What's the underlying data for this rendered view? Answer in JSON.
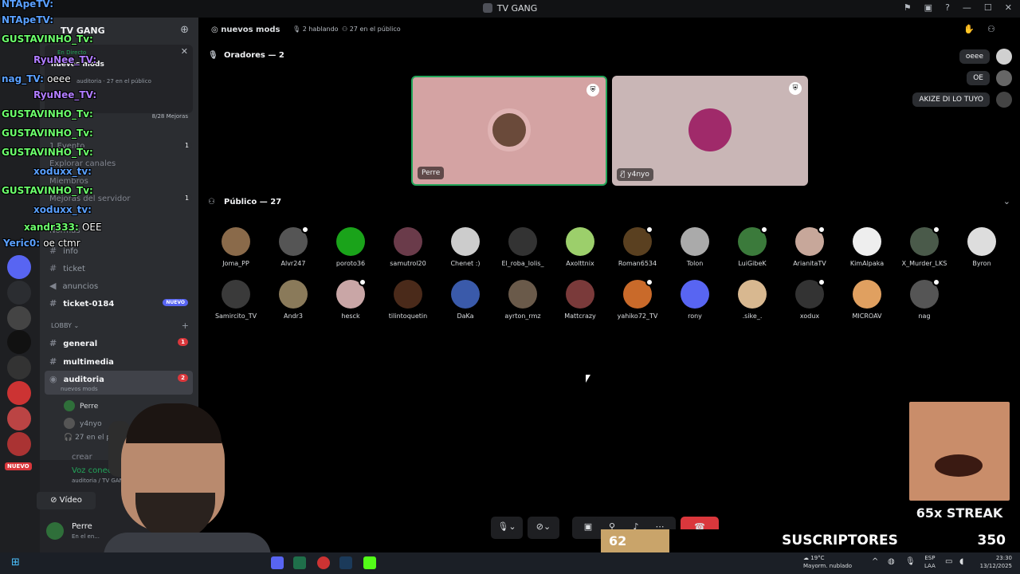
{
  "window": {
    "title": "TV GANG"
  },
  "sidebar": {
    "guild_name": "TV GANG",
    "live": {
      "status": "En Directo",
      "channel": "nuevos mods",
      "meta": "auditoria · 27 en el público"
    },
    "mejoras": "8/28 Mejoras",
    "rows": [
      {
        "label": "1 Evento",
        "count": "1"
      },
      {
        "label": "Explorar canales",
        "count": ""
      },
      {
        "label": "Miembros",
        "count": ""
      },
      {
        "label": "Mejoras del servidor",
        "count": "1"
      },
      {
        "label": "Normas",
        "count": ""
      }
    ],
    "channels": [
      {
        "name": "info"
      },
      {
        "name": "ticket"
      },
      {
        "name": "anuncios"
      },
      {
        "name": "ticket-0184",
        "pill": "NUEVO"
      }
    ],
    "lobby": "LOBBY",
    "lobby_channels": [
      {
        "name": "general",
        "badge": "1"
      },
      {
        "name": "multimedia",
        "badge": ""
      },
      {
        "name": "auditoria",
        "badge": "2",
        "sub": "nuevos mods"
      }
    ],
    "voice_members": [
      "Perre",
      "y4nyo",
      "27 en el público"
    ],
    "crear": "crear",
    "nuevo_badge": "NUEVO",
    "voice_connected": {
      "title": "Voz conectada",
      "sub": "auditoria / TV GANG",
      "video": "Vídeo"
    },
    "user": {
      "name": "Perre",
      "status": "En el en..."
    }
  },
  "stage": {
    "channel": "nuevos mods",
    "speaking": "2 hablando",
    "audience_count": "27 en el público",
    "speakers_header": "Oradores — 2",
    "audience_header": "Público — 27",
    "speakers": [
      {
        "name": "Perre"
      },
      {
        "name": "y4nyo"
      }
    ],
    "chat": [
      "oeee",
      "OE",
      "AKIZE DI LO TUYO"
    ],
    "audience": [
      "Joma_PP",
      "Alvr247",
      "poroto36",
      "samutrol20",
      "Chenet :)",
      "El_roba_lolis_",
      "Axolttnix",
      "Roman6534",
      "Tolon",
      "LuiGibeK",
      "ArianitaTV",
      "KimAlpaka",
      "X_Murder_LKS",
      "Byron",
      "Samircito_TV",
      "Andr3",
      "hesck",
      "tilintoquetin",
      "DaKa",
      "ayrton_rmz",
      "Mattcrazy",
      "yahiko72_TV",
      "rony",
      ".sike_.",
      "xodux",
      "MICROAV",
      "nag"
    ],
    "audience_colors": [
      "#8a6a4a",
      "#555",
      "#1aa31a",
      "#6a3b4a",
      "#ccc",
      "#333",
      "#9ccf6b",
      "#5a4020",
      "#aaa",
      "#3b7a3b",
      "#c7a79a",
      "#eee",
      "#4a5a4a",
      "#ddd",
      "#3a3a3a",
      "#8a7a5a",
      "#c9a6a6",
      "#4a2a1a",
      "#3a5aaa",
      "#6a5a4a",
      "#7a3a3a",
      "#c96a2a",
      "#5865f2",
      "#d8b890",
      "#333",
      "#e0a060",
      "#555"
    ],
    "accent": "#23a55a",
    "danger": "#da373c"
  },
  "overlay": {
    "chat": [
      {
        "user": "NTApeTV:",
        "msg": "",
        "color": "#5aa0ff"
      },
      {
        "user": "NTApeTV:",
        "msg": "",
        "color": "#5aa0ff"
      },
      {
        "user": "GUSTAVINHO_Tv:",
        "msg": "",
        "color": "#6cff6c"
      },
      {
        "user": "RyuNee_TV:",
        "msg": "",
        "color": "#b07cff"
      },
      {
        "user": "nag_TV:",
        "msg": "oeee",
        "color": "#5aa0ff"
      },
      {
        "user": "RyuNee_TV:",
        "msg": "",
        "color": "#b07cff"
      },
      {
        "user": "GUSTAVINHO_Tv:",
        "msg": "",
        "color": "#6cff6c"
      },
      {
        "user": "GUSTAVINHO_Tv:",
        "msg": "",
        "color": "#6cff6c"
      },
      {
        "user": "GUSTAVINHO_Tv:",
        "msg": "",
        "color": "#6cff6c"
      },
      {
        "user": "xoduxx_tv:",
        "msg": "",
        "color": "#5aa0ff"
      },
      {
        "user": "GUSTAVINHO_Tv:",
        "msg": "",
        "color": "#6cff6c"
      },
      {
        "user": "xoduxx_tv:",
        "msg": "",
        "color": "#5aa0ff"
      },
      {
        "user": "xandr333:",
        "msg": "OEE",
        "color": "#6cff6c"
      },
      {
        "user": "Yeric0:",
        "msg": "oe ctmr",
        "color": "#5aa0ff"
      }
    ],
    "streak": "65x STREAK",
    "subs": {
      "current": "62",
      "label": "SUSCRIPTORES",
      "goal": "350"
    }
  },
  "taskbar": {
    "weather_temp": "19°C",
    "weather_desc": "Mayorm. nublado",
    "lang_top": "ESP",
    "lang_bottom": "LAA",
    "time": "23:30",
    "date": "13/12/2025"
  }
}
